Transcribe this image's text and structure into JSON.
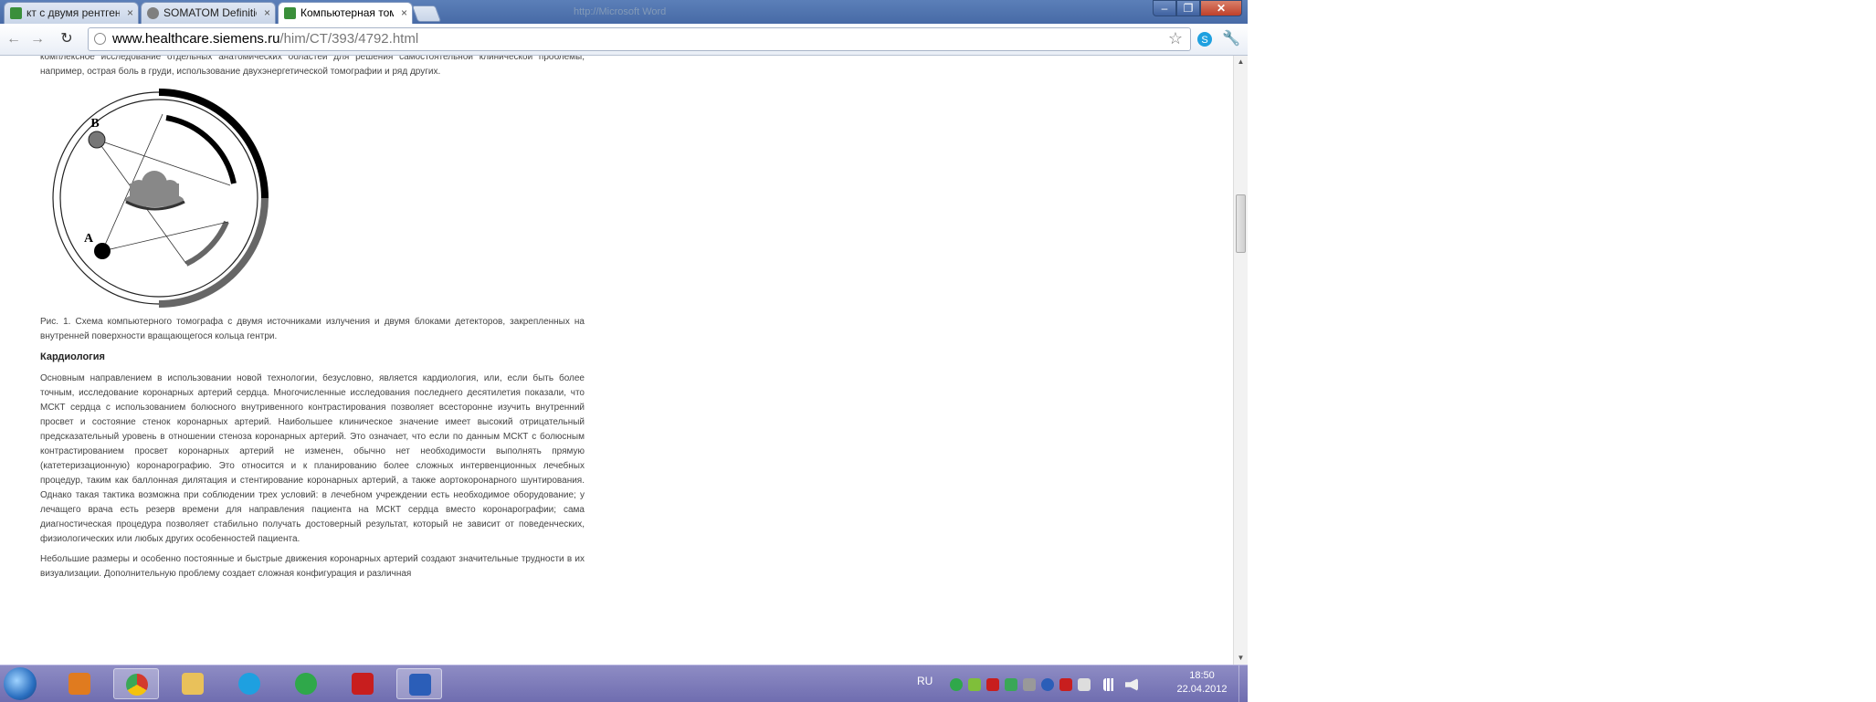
{
  "browser": {
    "tabs": [
      {
        "label": "кт с двумя рентгеновским",
        "favicon_color": "#3a8f3a",
        "active": false
      },
      {
        "label": "SOMATOM Definition - - Si",
        "favicon_color": "#7f7f7f",
        "active": false
      },
      {
        "label": "Компьютерная томограф",
        "favicon_color": "#3a8f3a",
        "active": true
      }
    ],
    "ghost_tab_label": "http://Microsoft Word",
    "window_buttons": {
      "minimize": "–",
      "maximize": "❐",
      "close": "✕"
    },
    "nav": {
      "back": "←",
      "forward": "→",
      "reload": "↻"
    },
    "url_host": "www.healthcare.siemens.ru",
    "url_path": "/him/CT/393/4792.html"
  },
  "article": {
    "intro": "комплексное исследование отдельных анатомических областей для решения самостоятельной клинической проблемы, например, острая боль в груди, использование двухэнергетической томографии и ряд других.",
    "figure": {
      "label_a": "A",
      "label_b": "B"
    },
    "caption": "Рис. 1. Схема компьютерного томографа с двумя источниками излучения и двумя блоками детекторов, закрепленных на внутренней поверхности вращающегося кольца гентри.",
    "section_title": "Кардиология",
    "paragraph1": "Основным направлением в использовании новой технологии, безусловно, является кардиология, или, если быть более точным, исследование коронарных артерий сердца. Многочисленные исследования последнего десятилетия показали, что МСКТ сердца с использованием болюсного внутривенного контрастирования позволяет всесторонне изучить внутренний просвет и состояние стенок коронарных артерий. Наибольшее клиническое значение имеет высокий отрицательный предсказательный уровень в отношении стеноза коронарных артерий. Это означает, что если по данным МСКТ с болюсным контрастированием просвет коронарных артерий не изменен, обычно нет необходимости выполнять прямую (катетеризационную) коронарографию. Это относится и к планированию более сложных интервенционных лечебных процедур, таким как баллонная дилятация и стентирование коронарных артерий, а также аортокоронарного шунтирования. Однако такая тактика возможна при соблюдении трех условий: в лечебном учреждении есть необходимое оборудование; у лечащего врача есть резерв времени для направления пациента на МСКТ сердца вместо коронарографии; сама диагностическая процедура позволяет стабильно получать достоверный результат, который не зависит от поведенческих, физиологических или любых других особенностей пациента.",
    "paragraph2": "Небольшие размеры и особенно постоянные и быстрые движения коронарных артерий создают значительные трудности в их визуализации. Дополнительную проблему создает сложная конфигурация и различная"
  },
  "taskbar": {
    "apps": [
      {
        "name": "media-player",
        "color": "#e07b1f"
      },
      {
        "name": "chrome",
        "color": "#d33a2c",
        "active": true
      },
      {
        "name": "explorer",
        "color": "#e9c15a"
      },
      {
        "name": "skype",
        "color": "#1ea0e0"
      },
      {
        "name": "mail-agent",
        "color": "#2fa84a"
      },
      {
        "name": "acrobat",
        "color": "#c81e1e"
      },
      {
        "name": "word",
        "color": "#2b5eb8",
        "active": true
      }
    ],
    "language": "RU",
    "time": "18:50",
    "date": "22.04.2012"
  }
}
